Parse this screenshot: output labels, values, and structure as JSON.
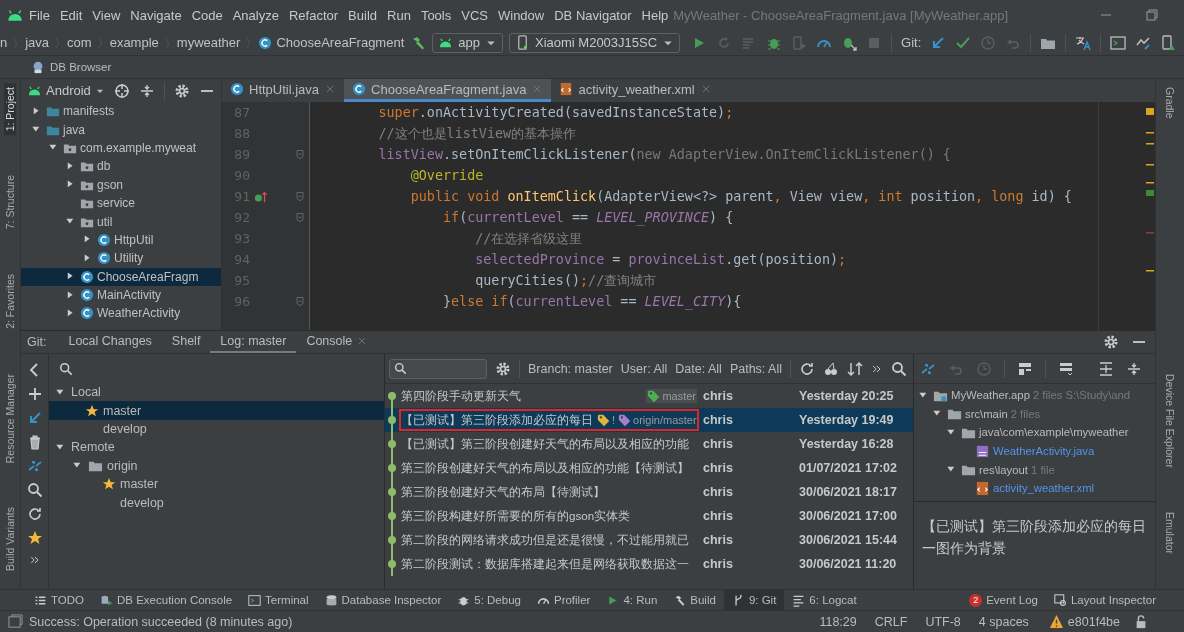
{
  "menu_bar": {
    "items": [
      "File",
      "Edit",
      "View",
      "Navigate",
      "Code",
      "Analyze",
      "Refactor",
      "Build",
      "Run",
      "Tools",
      "VCS",
      "Window",
      "DB Navigator",
      "Help"
    ],
    "title": "MyWeather - ChooseAreaFragment.java [MyWeather.app]"
  },
  "nav_bar": {
    "breadcrumb": [
      {
        "label": "n",
        "kind": "folder"
      },
      {
        "label": "java",
        "kind": "folder"
      },
      {
        "label": "com",
        "kind": "folder"
      },
      {
        "label": "example",
        "kind": "folder"
      },
      {
        "label": "myweather",
        "kind": "folder"
      },
      {
        "label": "ChooseAreaFragment",
        "kind": "class"
      }
    ],
    "run_config": "app",
    "device": "Xiaomi M2003J15SC",
    "vcs_label": "Git:"
  },
  "db_browser": {
    "label": "DB Browser"
  },
  "left_stripe_top": [
    {
      "label": "1: Project",
      "selected": true
    },
    {
      "label": "7: Structure",
      "selected": false
    },
    {
      "label": "2: Favorites",
      "selected": false
    }
  ],
  "left_stripe_bottom": [
    {
      "label": "Resource Manager",
      "selected": false
    },
    {
      "label": "Build Variants",
      "selected": false
    }
  ],
  "right_stripe_top": [
    {
      "label": "Gradle",
      "selected": false
    }
  ],
  "right_stripe_bottom": [
    {
      "label": "Device File Explorer",
      "selected": false
    },
    {
      "label": "Emulator",
      "selected": false
    }
  ],
  "project": {
    "view": "Android",
    "tree": [
      {
        "name": "manifests",
        "kind": "folder",
        "expandable": true,
        "expanded": false,
        "selected": false
      },
      {
        "name": "java",
        "kind": "folder",
        "expandable": true,
        "expanded": true,
        "selected": false,
        "children": [
          {
            "name": "com.example.myweat",
            "kind": "package",
            "expandable": true,
            "expanded": true,
            "selected": false,
            "children": [
              {
                "name": "db",
                "kind": "package",
                "expandable": true,
                "expanded": false,
                "selected": false
              },
              {
                "name": "gson",
                "kind": "package",
                "expandable": true,
                "expanded": false,
                "selected": false
              },
              {
                "name": "service",
                "kind": "package",
                "expandable": false,
                "selected": false
              },
              {
                "name": "util",
                "kind": "package",
                "expandable": true,
                "expanded": true,
                "selected": false,
                "children": [
                  {
                    "name": "HttpUtil",
                    "kind": "class",
                    "expandable": true,
                    "expanded": false,
                    "selected": false
                  },
                  {
                    "name": "Utility",
                    "kind": "class",
                    "expandable": true,
                    "expanded": false,
                    "selected": false
                  }
                ]
              },
              {
                "name": "ChooseAreaFragm",
                "kind": "class",
                "expandable": true,
                "expanded": false,
                "selected": true
              },
              {
                "name": "MainActivity",
                "kind": "class",
                "expandable": true,
                "expanded": false,
                "selected": false
              },
              {
                "name": "WeatherActivity",
                "kind": "class",
                "expandable": true,
                "expanded": false,
                "selected": false
              }
            ]
          }
        ]
      }
    ]
  },
  "editor": {
    "tabs": [
      {
        "label": "HttpUtil.java",
        "kind": "class",
        "selected": false
      },
      {
        "label": "ChooseAreaFragment.java",
        "kind": "class",
        "selected": true
      },
      {
        "label": "activity_weather.xml",
        "kind": "xml",
        "selected": false
      }
    ],
    "lines": [
      {
        "number": "87",
        "fold": false,
        "override": false,
        "tokens": [
          {
            "kind": "keyword",
            "text": "        super"
          },
          {
            "kind": "plain",
            "text": ".onActivityCreated(savedInstanceState)"
          },
          {
            "kind": "keyword",
            "text": ";"
          }
        ]
      },
      {
        "number": "88",
        "fold": false,
        "override": false,
        "tokens": [
          {
            "kind": "comment",
            "text": "        //这个也是listView的基本操作"
          }
        ]
      },
      {
        "number": "89",
        "fold": true,
        "override": false,
        "tokens": [
          {
            "kind": "field",
            "text": "        listView"
          },
          {
            "kind": "plain",
            "text": ".setOnItemClickListener("
          },
          {
            "kind": "dim",
            "text": "new AdapterView.OnItemClickListener() {"
          }
        ]
      },
      {
        "number": "90",
        "fold": false,
        "override": false,
        "tokens": [
          {
            "kind": "annotation",
            "text": "            @Override"
          }
        ]
      },
      {
        "number": "91",
        "fold": true,
        "override": true,
        "tokens": [
          {
            "kind": "keyword",
            "text": "            public void "
          },
          {
            "kind": "method",
            "text": "onItemClick"
          },
          {
            "kind": "plain",
            "text": "(AdapterView<?> parent"
          },
          {
            "kind": "keyword",
            "text": ", "
          },
          {
            "kind": "plain",
            "text": "View view"
          },
          {
            "kind": "keyword",
            "text": ", int "
          },
          {
            "kind": "plain",
            "text": "position"
          },
          {
            "kind": "keyword",
            "text": ", long "
          },
          {
            "kind": "plain",
            "text": "id) {"
          }
        ]
      },
      {
        "number": "92",
        "fold": true,
        "override": false,
        "tokens": [
          {
            "kind": "keyword",
            "text": "                if"
          },
          {
            "kind": "plain",
            "text": "("
          },
          {
            "kind": "field",
            "text": "currentLevel"
          },
          {
            "kind": "plain",
            "text": " == "
          },
          {
            "kind": "constant",
            "text": "LEVEL_PROVINCE"
          },
          {
            "kind": "plain",
            "text": ") {"
          }
        ]
      },
      {
        "number": "93",
        "fold": false,
        "override": false,
        "tokens": [
          {
            "kind": "comment",
            "text": "                    //在选择省级这里"
          }
        ]
      },
      {
        "number": "94",
        "fold": false,
        "override": false,
        "tokens": [
          {
            "kind": "field",
            "text": "                    selectedProvince"
          },
          {
            "kind": "plain",
            "text": " = "
          },
          {
            "kind": "field",
            "text": "provinceList"
          },
          {
            "kind": "plain",
            "text": ".get(position)"
          },
          {
            "kind": "keyword",
            "text": ";"
          }
        ]
      },
      {
        "number": "95",
        "fold": false,
        "override": false,
        "tokens": [
          {
            "kind": "plain",
            "text": "                    queryCities()"
          },
          {
            "kind": "keyword",
            "text": ";"
          },
          {
            "kind": "comment",
            "text": "//查询城市"
          }
        ]
      },
      {
        "number": "96",
        "fold": true,
        "override": false,
        "tokens": [
          {
            "kind": "plain",
            "text": "                }"
          },
          {
            "kind": "keyword",
            "text": "else if"
          },
          {
            "kind": "plain",
            "text": "("
          },
          {
            "kind": "field",
            "text": "currentLevel"
          },
          {
            "kind": "plain",
            "text": " == "
          },
          {
            "kind": "constant",
            "text": "LEVEL_CITY"
          },
          {
            "kind": "plain",
            "text": "){"
          }
        ]
      }
    ]
  },
  "git_panel": {
    "label": "Git:",
    "tabs": [
      {
        "label": "Local Changes",
        "selected": false,
        "closable": false
      },
      {
        "label": "Shelf",
        "selected": false,
        "closable": false
      },
      {
        "label": "Log: master",
        "selected": true,
        "closable": false
      },
      {
        "label": "Console",
        "selected": false,
        "closable": true
      }
    ],
    "branches": [
      {
        "name": "Local",
        "kind": "group",
        "expanded": true,
        "selected": false,
        "children": [
          {
            "name": "master",
            "kind": "branch",
            "starred": true,
            "selected": true
          },
          {
            "name": "develop",
            "kind": "branch",
            "starred": false,
            "selected": false
          }
        ]
      },
      {
        "name": "Remote",
        "kind": "group",
        "expanded": true,
        "selected": false,
        "children": [
          {
            "name": "origin",
            "kind": "remote",
            "expanded": true,
            "selected": false,
            "children": [
              {
                "name": "master",
                "kind": "branch",
                "starred": true,
                "selected": false
              },
              {
                "name": "develop",
                "kind": "branch",
                "starred": false,
                "selected": false
              }
            ]
          }
        ]
      }
    ],
    "filters": [
      "Branch: master",
      "User: All",
      "Date: All",
      "Paths: All"
    ],
    "rows": [
      {
        "subject": "第四阶段手动更新天气",
        "tags": [
          {
            "text": "master",
            "color": "#4caf50"
          }
        ],
        "author": "chris",
        "date": "Yesterday 20:25",
        "selected": false,
        "highlighted": false
      },
      {
        "subject": "【已测试】第三阶段添加必应的每日",
        "tags": [
          {
            "text": "!",
            "color": "#e0b63a"
          },
          {
            "text": "origin/master",
            "color": "#a57dc8"
          }
        ],
        "author": "chris",
        "date": "Yesterday 19:49",
        "selected": true,
        "highlighted": true
      },
      {
        "subject": "【已测试】第三阶段创建好天气的布局以及相应的功能",
        "tags": [],
        "author": "chris",
        "date": "Yesterday 16:28",
        "selected": false,
        "highlighted": false
      },
      {
        "subject": "第三阶段创建好天气的布局以及相应的功能【待测试】",
        "tags": [],
        "author": "chris",
        "date": "01/07/2021 17:02",
        "selected": false,
        "highlighted": false
      },
      {
        "subject": "第三阶段创建好天气的布局【待测试】",
        "tags": [],
        "author": "chris",
        "date": "30/06/2021 18:17",
        "selected": false,
        "highlighted": false
      },
      {
        "subject": "第三阶段构建好所需要的所有的gson实体类",
        "tags": [],
        "author": "chris",
        "date": "30/06/2021 17:00",
        "selected": false,
        "highlighted": false
      },
      {
        "subject": "第二阶段的网络请求成功但是还是很慢，不过能用就已",
        "tags": [],
        "author": "chris",
        "date": "30/06/2021 15:44",
        "selected": false,
        "highlighted": false
      },
      {
        "subject": "第二阶段测试：数据库搭建起来但是网络获取数据这一",
        "tags": [],
        "author": "chris",
        "date": "30/06/2021 11:20",
        "selected": false,
        "highlighted": false
      }
    ],
    "changes": [
      {
        "name": "MyWeather.app",
        "kind": "module",
        "note": "2 files",
        "path": "S:\\Study\\and",
        "children": [
          {
            "name": "src\\main",
            "kind": "folder",
            "note": "2 files",
            "children": [
              {
                "name": "java\\com\\example\\myweather",
                "kind": "folder",
                "children": [
                  {
                    "name": "WeatherActivity.java",
                    "kind": "java"
                  }
                ]
              },
              {
                "name": "res\\layout",
                "kind": "folder",
                "note": "1 file",
                "children": [
                  {
                    "name": "activity_weather.xml",
                    "kind": "xml"
                  }
                ]
              }
            ]
          }
        ]
      }
    ],
    "message": "【已测试】第三阶段添加必应的每日一图作为背景"
  },
  "tool_windows_left": [
    {
      "label": "TODO",
      "kind": "todo",
      "selected": false
    },
    {
      "label": "DB Execution Console",
      "kind": "db-console",
      "selected": false
    },
    {
      "label": "Terminal",
      "kind": "terminal",
      "selected": false
    },
    {
      "label": "Database Inspector",
      "kind": "database",
      "selected": false
    },
    {
      "label": "5: Debug",
      "kind": "debug",
      "selected": false
    },
    {
      "label": "Profiler",
      "kind": "profiler",
      "selected": false
    },
    {
      "label": "4: Run",
      "kind": "run",
      "selected": false
    },
    {
      "label": "Build",
      "kind": "build",
      "selected": false
    },
    {
      "label": "9: Git",
      "kind": "git",
      "selected": true
    },
    {
      "label": "6: Logcat",
      "kind": "logcat",
      "selected": false
    }
  ],
  "tool_windows_right": [
    {
      "label": "Event Log",
      "kind": "event-log",
      "badge": "2",
      "selected": false
    },
    {
      "label": "Layout Inspector",
      "kind": "layout-inspector",
      "selected": false
    }
  ],
  "status_bar": {
    "message": "Success: Operation succeeded (8 minutes ago)",
    "items": [
      "118:29",
      "CRLF",
      "UTF-8",
      "4 spaces"
    ],
    "branch": "e801f4be"
  }
}
